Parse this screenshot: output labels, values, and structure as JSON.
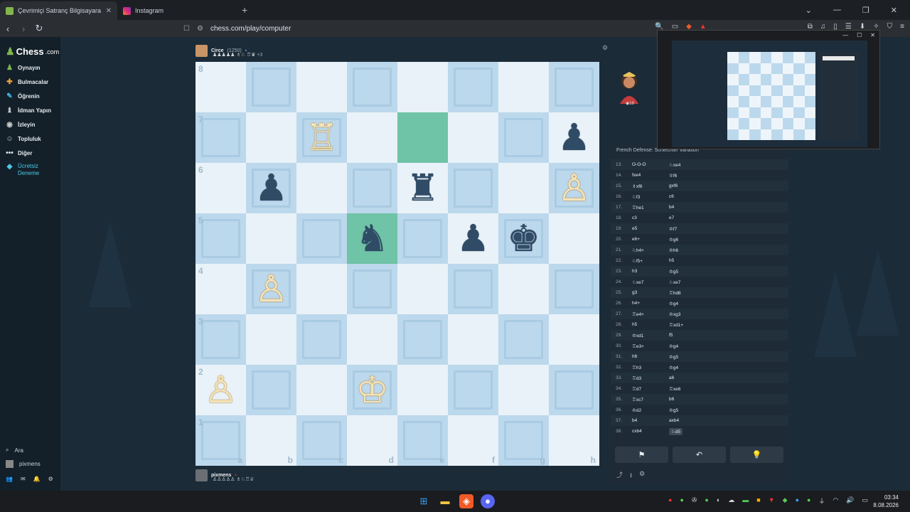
{
  "browser": {
    "tabs": [
      {
        "label": "Çevrimiçi Satranç Bilgisayara Ka",
        "active": true,
        "icon": "chesscom-favicon",
        "color": "#81b64c"
      },
      {
        "label": "Instagram",
        "active": false,
        "icon": "instagram-favicon",
        "color": "#d6249f"
      }
    ],
    "url": "chess.com/play/computer"
  },
  "sidebar": {
    "logo": "Chess",
    "logo_suffix": ".com",
    "items": [
      {
        "label": "Oynayın",
        "icon": "play-icon"
      },
      {
        "label": "Bulmacalar",
        "icon": "puzzle-icon"
      },
      {
        "label": "Öğrenin",
        "icon": "learn-icon"
      },
      {
        "label": "İdman Yapın",
        "icon": "train-icon"
      },
      {
        "label": "İzleyin",
        "icon": "watch-icon"
      },
      {
        "label": "Topluluk",
        "icon": "community-icon"
      },
      {
        "label": "Diğer",
        "icon": "more-icon"
      },
      {
        "label": "Ücretsiz",
        "label2": "Deneme",
        "icon": "diamond-icon"
      }
    ],
    "search": "Ara",
    "user": "pixmens"
  },
  "top_player": {
    "name": "Circe",
    "rating": "(1250)",
    "captured": "♟♟♟♟♟ ♗♘ ♖♛",
    "extra": "+3"
  },
  "bottom_player": {
    "name": "pixmens",
    "captured": "♙♙♙♙♙ ♗♘♖♕"
  },
  "board": {
    "ranks": [
      "8",
      "7",
      "6",
      "5",
      "4",
      "3",
      "2",
      "1"
    ],
    "files": [
      "a",
      "b",
      "c",
      "d",
      "e",
      "f",
      "g",
      "h"
    ],
    "highlight": [
      "e7",
      "d5"
    ],
    "pieces": {
      "c7": {
        "glyph": "♖",
        "color": "w"
      },
      "h7": {
        "glyph": "♟",
        "color": "b"
      },
      "b6": {
        "glyph": "♟",
        "color": "b"
      },
      "e6": {
        "glyph": "♜",
        "color": "b"
      },
      "h6": {
        "glyph": "♙",
        "color": "w"
      },
      "d5": {
        "glyph": "♞",
        "color": "b"
      },
      "f5": {
        "glyph": "♟",
        "color": "b"
      },
      "g5": {
        "glyph": "♚",
        "color": "b"
      },
      "b4": {
        "glyph": "♙",
        "color": "w"
      },
      "a2": {
        "glyph": "♙",
        "color": "w"
      },
      "d2": {
        "glyph": "♔",
        "color": "w"
      }
    }
  },
  "opponent": {
    "rating_badge": "18"
  },
  "opening_name": "French Defense: Schlechter Variation",
  "moves": [
    {
      "n": "13.",
      "w": "O-O-O",
      "b": "♘xe4"
    },
    {
      "n": "14.",
      "w": "fxe4",
      "b": "♕f6"
    },
    {
      "n": "15.",
      "w": "♗xf6",
      "b": "gxf6"
    },
    {
      "n": "16.",
      "w": "♘f3",
      "b": "c6"
    },
    {
      "n": "17.",
      "w": "♖he1",
      "b": "b4"
    },
    {
      "n": "18.",
      "w": "c3",
      "b": "e7"
    },
    {
      "n": "19.",
      "w": "e5",
      "b": "♔f7"
    },
    {
      "n": "20.",
      "w": "e6+",
      "b": "♔g6"
    },
    {
      "n": "21.",
      "w": "♘h4+",
      "b": "♔h6"
    },
    {
      "n": "22.",
      "w": "♘f5+",
      "b": "h5"
    },
    {
      "n": "23.",
      "w": "h3",
      "b": "♔g5"
    },
    {
      "n": "24.",
      "w": "♘xe7",
      "b": "♘xe7"
    },
    {
      "n": "25.",
      "w": "g3",
      "b": "♖hd8"
    },
    {
      "n": "26.",
      "w": "h4+",
      "b": "♔g4"
    },
    {
      "n": "27.",
      "w": "♖e4+",
      "b": "♔xg3"
    },
    {
      "n": "28.",
      "w": "h5",
      "b": "♖xd1+"
    },
    {
      "n": "29.",
      "w": "♔xd1",
      "b": "f5"
    },
    {
      "n": "30.",
      "w": "♖e3+",
      "b": "♔g4"
    },
    {
      "n": "31.",
      "w": "h6",
      "b": "♔g5"
    },
    {
      "n": "32.",
      "w": "♖h3",
      "b": "♔g4"
    },
    {
      "n": "33.",
      "w": "♖d3",
      "b": "a6"
    },
    {
      "n": "34.",
      "w": "♖d7",
      "b": "♖xe6"
    },
    {
      "n": "35.",
      "w": "♖xc7",
      "b": "b6"
    },
    {
      "n": "36.",
      "w": "♔d2",
      "b": "♔g5"
    },
    {
      "n": "37.",
      "w": "b4",
      "b": "axb4"
    },
    {
      "n": "38.",
      "w": "cxb4",
      "b": "♘d5"
    }
  ],
  "controls": {
    "resign": "⚑",
    "takeback": "↶",
    "hint": "💡"
  },
  "taskbar": {
    "time": "03:34",
    "date": "8.08.2026"
  }
}
